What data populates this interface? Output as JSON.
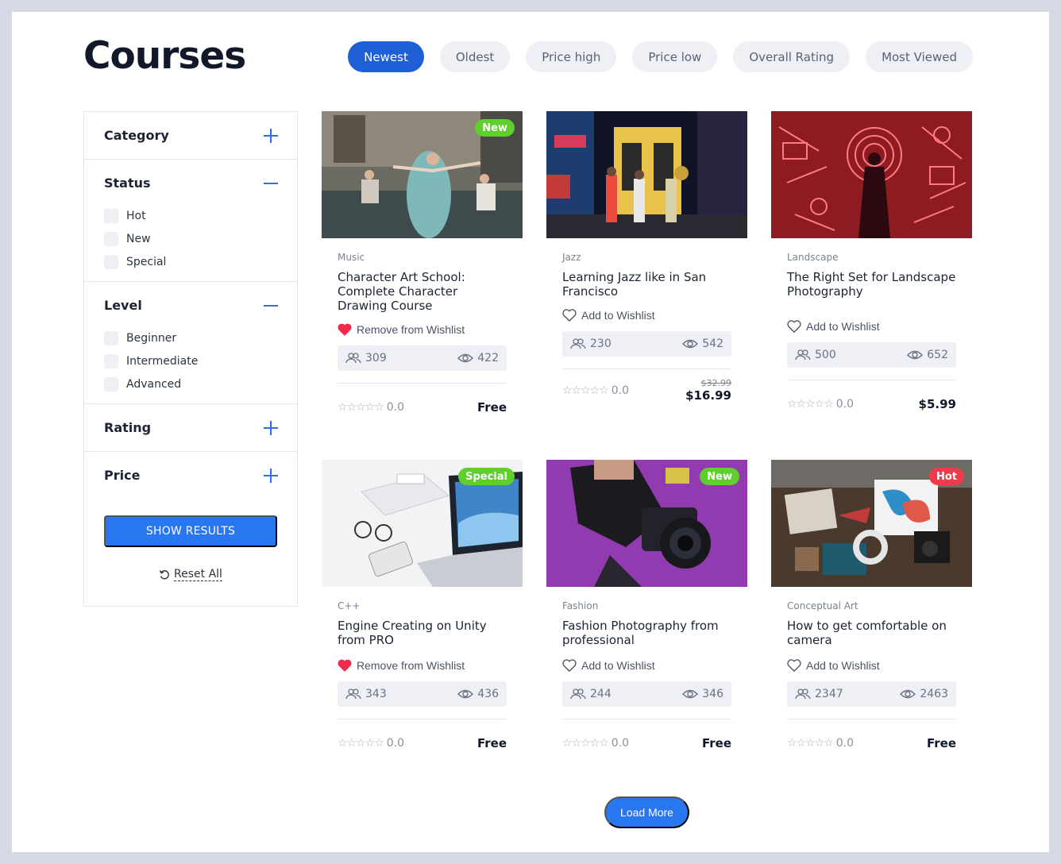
{
  "page_title": "Courses",
  "sort_tabs": [
    {
      "label": "Newest",
      "active": true
    },
    {
      "label": "Oldest",
      "active": false
    },
    {
      "label": "Price high",
      "active": false
    },
    {
      "label": "Price low",
      "active": false
    },
    {
      "label": "Overall Rating",
      "active": false
    },
    {
      "label": "Most Viewed",
      "active": false
    }
  ],
  "sidebar": {
    "category": {
      "label": "Category",
      "expanded": false
    },
    "status": {
      "label": "Status",
      "expanded": true,
      "options": [
        "Hot",
        "New",
        "Special"
      ]
    },
    "level": {
      "label": "Level",
      "expanded": true,
      "options": [
        "Beginner",
        "Intermediate",
        "Advanced"
      ]
    },
    "rating": {
      "label": "Rating",
      "expanded": false
    },
    "price": {
      "label": "Price",
      "expanded": false
    },
    "show_results": "SHOW RESULTS",
    "reset_all": "Reset All"
  },
  "courses": [
    {
      "category": "Music",
      "title": "Character Art School: Complete Character Drawing Course",
      "badge": "New",
      "wishlist": "Remove from Wishlist",
      "wishlisted": true,
      "students": "309",
      "views": "422",
      "rating": "0.0",
      "price": "Free",
      "old_price": ""
    },
    {
      "category": "Jazz",
      "title": "Learning Jazz like in San Francisco",
      "badge": "",
      "wishlist": "Add to Wishlist",
      "wishlisted": false,
      "students": "230",
      "views": "542",
      "rating": "0.0",
      "price": "$16.99",
      "old_price": "$32.99"
    },
    {
      "category": "Landscape",
      "title": "The Right Set for Landscape Photography",
      "badge": "",
      "wishlist": "Add to Wishlist",
      "wishlisted": false,
      "students": "500",
      "views": "652",
      "rating": "0.0",
      "price": "$5.99",
      "old_price": ""
    },
    {
      "category": "C++",
      "title": "Engine Creating on Unity from PRO",
      "badge": "Special",
      "wishlist": "Remove from Wishlist",
      "wishlisted": true,
      "students": "343",
      "views": "436",
      "rating": "0.0",
      "price": "Free",
      "old_price": ""
    },
    {
      "category": "Fashion",
      "title": "Fashion Photography from professional",
      "badge": "New",
      "wishlist": "Add to Wishlist",
      "wishlisted": false,
      "students": "244",
      "views": "346",
      "rating": "0.0",
      "price": "Free",
      "old_price": ""
    },
    {
      "category": "Conceptual Art",
      "title": "How to get comfortable on camera",
      "badge": "Hot",
      "wishlist": "Add to Wishlist",
      "wishlisted": false,
      "students": "2347",
      "views": "2463",
      "rating": "0.0",
      "price": "Free",
      "old_price": ""
    }
  ],
  "load_more": "Load More",
  "colors": {
    "accent": "#2876f0",
    "active_tab": "#1f5fd6",
    "badge_new": "#5fcf2e",
    "badge_hot": "#f23a4b",
    "heart": "#f2294a"
  }
}
